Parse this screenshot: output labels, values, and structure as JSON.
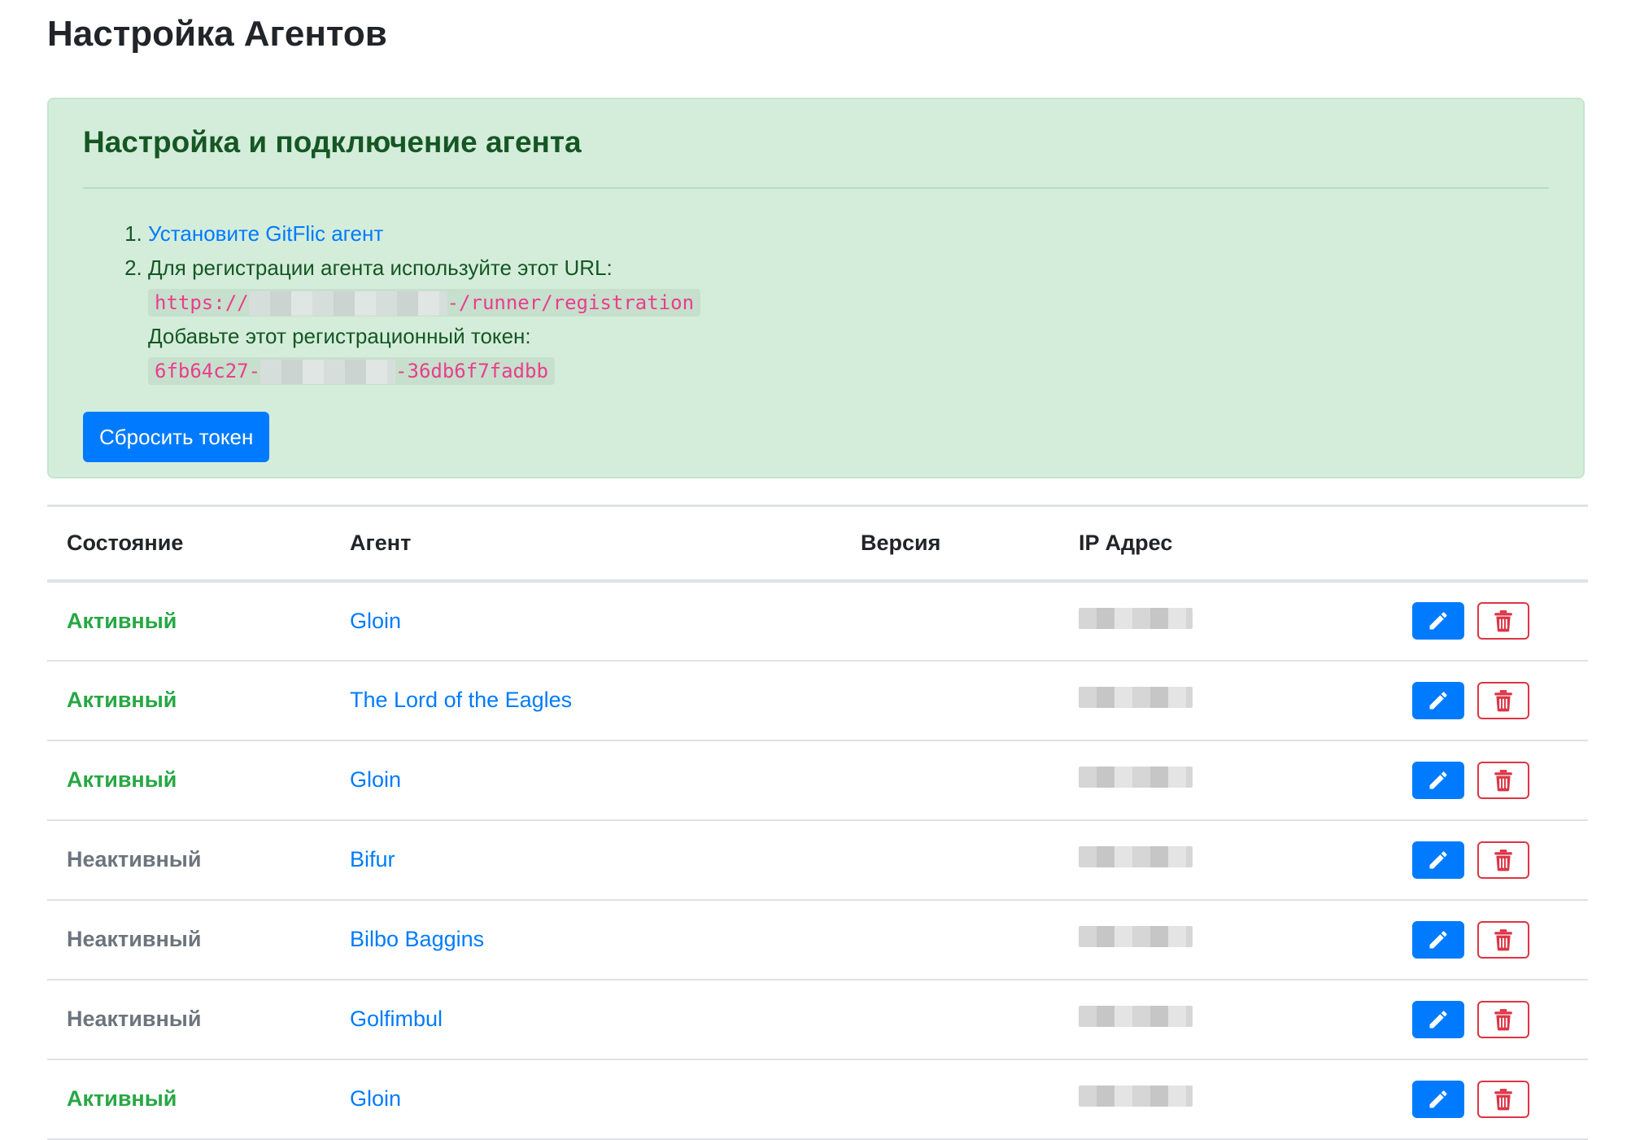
{
  "page": {
    "title": "Настройка Агентов"
  },
  "setup": {
    "heading": "Настройка и подключение агента",
    "step1_link": "Установите GitFlic агент",
    "step2_text": "Для регистрации агента используйте этот URL:",
    "url_prefix": "https://",
    "url_suffix": "-/runner/registration",
    "token_label": "Добавьте этот регистрационный токен:",
    "token_prefix": "6fb64c27-",
    "token_suffix": "-36db6f7fadbb",
    "reset_button": "Сбросить токен"
  },
  "table": {
    "headers": {
      "status": "Состояние",
      "agent": "Агент",
      "version": "Версия",
      "ip": "IP Адрес"
    },
    "rows": [
      {
        "status": "Активный",
        "status_kind": "active",
        "agent": "Gloin",
        "version": ""
      },
      {
        "status": "Активный",
        "status_kind": "active",
        "agent": "The Lord of the Eagles",
        "version": ""
      },
      {
        "status": "Активный",
        "status_kind": "active",
        "agent": "Gloin",
        "version": ""
      },
      {
        "status": "Неактивный",
        "status_kind": "inactive",
        "agent": "Bifur",
        "version": ""
      },
      {
        "status": "Неактивный",
        "status_kind": "inactive",
        "agent": "Bilbo Baggins",
        "version": ""
      },
      {
        "status": "Неактивный",
        "status_kind": "inactive",
        "agent": "Golfimbul",
        "version": ""
      },
      {
        "status": "Активный",
        "status_kind": "active",
        "agent": "Gloin",
        "version": ""
      }
    ],
    "row_actions": {
      "edit_icon": "pencil-icon",
      "delete_icon": "trash-icon"
    }
  },
  "colors": {
    "primary": "#007bff",
    "danger": "#dc3545",
    "success": "#28a745",
    "muted": "#6c757d",
    "alert_bg": "#d4edda",
    "alert_text": "#155724"
  }
}
